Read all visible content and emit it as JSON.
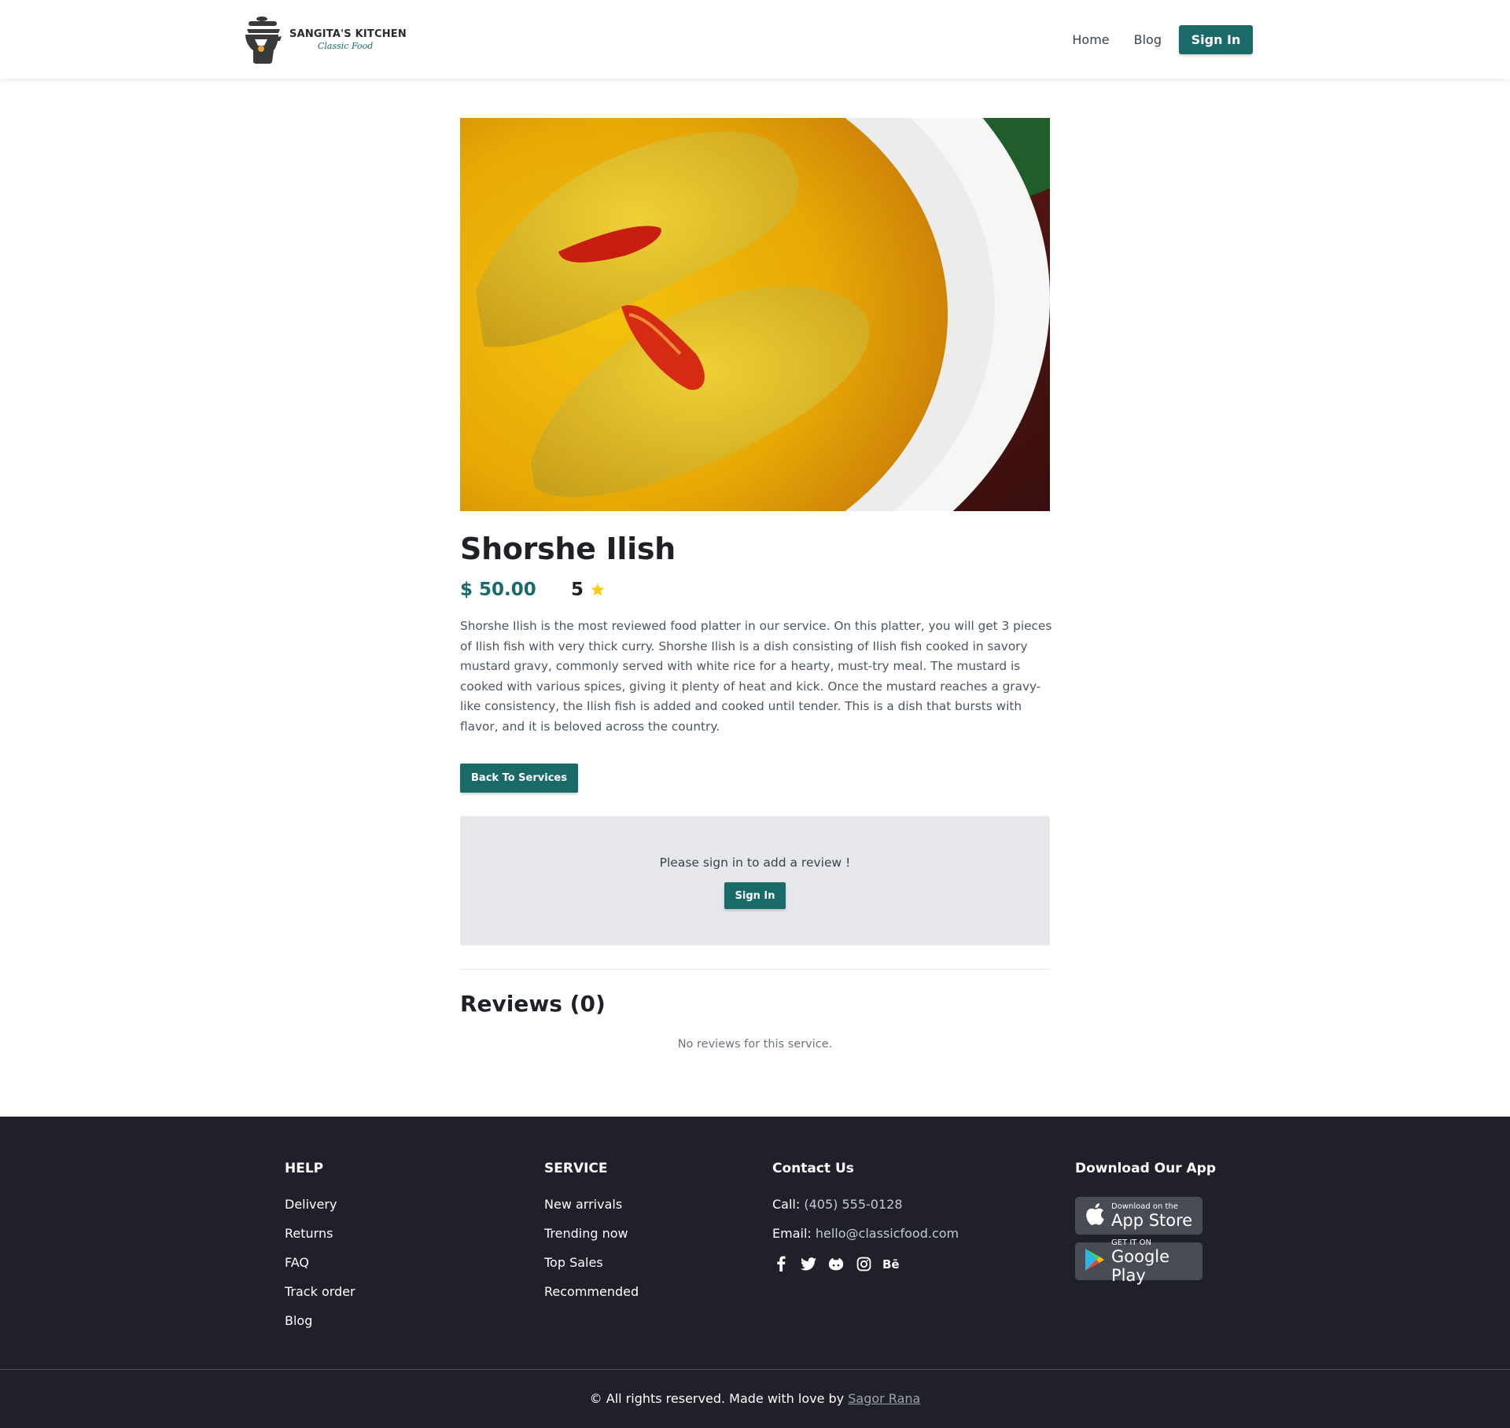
{
  "brand": {
    "name": "SANGITA'S KITCHEN",
    "tagline": "Classic Food"
  },
  "nav": {
    "home": "Home",
    "blog": "Blog",
    "sign_in": "Sign In"
  },
  "service": {
    "title": "Shorshe Ilish",
    "price": "$ 50.00",
    "rating": "5",
    "description": "Shorshe Ilish is the most reviewed food platter in our service. On this platter, you will get 3 pieces of Ilish fish with very thick curry. Shorshe Ilish is a dish consisting of Ilish fish cooked in savory mustard gravy, commonly served with white rice for a hearty, must-try meal. The mustard is cooked with various spices, giving it plenty of heat and kick. Once the mustard reaches a gravy-like consistency, the Ilish fish is added and cooked until tender. This is a dish that bursts with flavor, and it is beloved across the country.",
    "back_button": "Back To Services"
  },
  "review_prompt": {
    "message": "Please sign in to add a review !",
    "button": "Sign In"
  },
  "reviews": {
    "title": "Reviews (0)",
    "empty": "No reviews for this service."
  },
  "footer": {
    "help": {
      "heading": "HELP",
      "items": [
        "Delivery",
        "Returns",
        "FAQ",
        "Track order",
        "Blog"
      ]
    },
    "service": {
      "heading": "SERVICE",
      "items": [
        "New arrivals",
        "Trending now",
        "Top Sales",
        "Recommended"
      ]
    },
    "contact": {
      "heading": "Contact Us",
      "call_label": "Call:",
      "call_value": "(405) 555-0128",
      "email_label": "Email:",
      "email_value": "hello@classicfood.com",
      "social_icons": [
        "facebook-icon",
        "twitter-icon",
        "github-icon",
        "instagram-icon",
        "behance-icon"
      ]
    },
    "app": {
      "heading": "Download Our App",
      "appstore_small": "Download on the",
      "appstore_big": "App Store",
      "googleplay_small": "GET IT ON",
      "googleplay_big": "Google Play"
    },
    "copyright_text": "© All rights reserved. Made with love by",
    "author": "Sagor Rana"
  },
  "colors": {
    "accent": "#1b6a6a",
    "footer_bg": "#1f2029",
    "star": "#facc15",
    "review_box": "#e5e7eb"
  }
}
